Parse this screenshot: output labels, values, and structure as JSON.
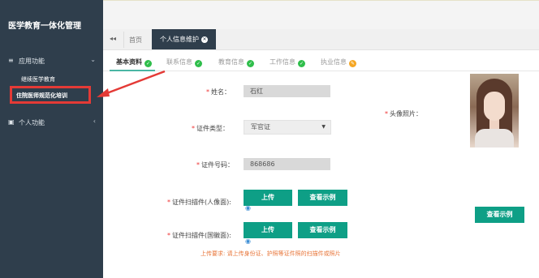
{
  "sidebar": {
    "brand": "医学教育一体化管理",
    "groups": [
      {
        "icon": "≡",
        "label": "应用功能",
        "chevron": "⌄"
      },
      {
        "icon": "▣",
        "label": "个人功能",
        "chevron": "‹"
      }
    ],
    "sub_items": [
      {
        "label": "继续医学教育"
      },
      {
        "label": "住院医师规范化培训"
      }
    ]
  },
  "tabs": {
    "back_icon": "◂◂",
    "home": "首页",
    "active": "个人信息维护",
    "close_icon": "✕"
  },
  "steps": [
    {
      "label": "基本资料",
      "status": "done"
    },
    {
      "label": "联系信息",
      "status": "done"
    },
    {
      "label": "教育信息",
      "status": "done"
    },
    {
      "label": "工作信息",
      "status": "done"
    },
    {
      "label": "执业信息",
      "status": "edit"
    }
  ],
  "form": {
    "name": {
      "label": "姓名：",
      "value": "石红"
    },
    "id_type": {
      "label": "证件类型：",
      "value": "军官证"
    },
    "id_number": {
      "label": "证件号码：",
      "value": "868686"
    },
    "scan_front": {
      "label": "证件扫描件(人像面):",
      "upload": "上传",
      "example": "查看示例"
    },
    "scan_back": {
      "label": "证件扫描件(国徽面):",
      "upload": "上传",
      "example": "查看示例"
    },
    "photo": {
      "label": "头像照片：",
      "example": "查看示例"
    },
    "hint": "上传要求: 请上传身份证、护照等证件照的扫描件或照片"
  },
  "colors": {
    "sidebar": "#2f3e4c",
    "accent": "#0e9f86",
    "required": "#e33333",
    "highlight": "#e43a36",
    "ok": "#2fbe4b",
    "edit": "#f5a623"
  }
}
